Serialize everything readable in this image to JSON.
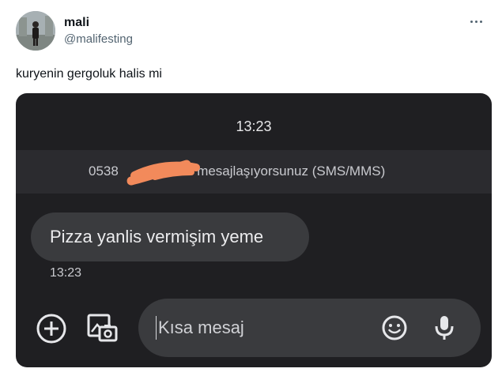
{
  "tweet": {
    "display_name": "mali",
    "handle": "@malifesting",
    "text": "kuryenin gergoluk halis mi"
  },
  "screenshot": {
    "time_top": "13:23",
    "conversation_prefix": "0538",
    "conversation_suffix": "27 ile mesajlaşıyorsunuz (SMS/MMS)",
    "message_text": "Pizza yanlis vermişim yeme",
    "message_time": "13:23",
    "compose_placeholder": "Kısa mesaj",
    "redaction_color": "#f28a5b"
  },
  "icons": {
    "more": "more-options-icon",
    "add": "add-circle-icon",
    "gallery": "gallery-camera-icon",
    "emoji": "emoji-icon",
    "mic": "microphone-icon"
  },
  "colors": {
    "background": "#ffffff",
    "media_background": "#1f1f22",
    "banner": "#2b2b2f",
    "bubble": "#3a3b3e",
    "handle": "#536471"
  }
}
